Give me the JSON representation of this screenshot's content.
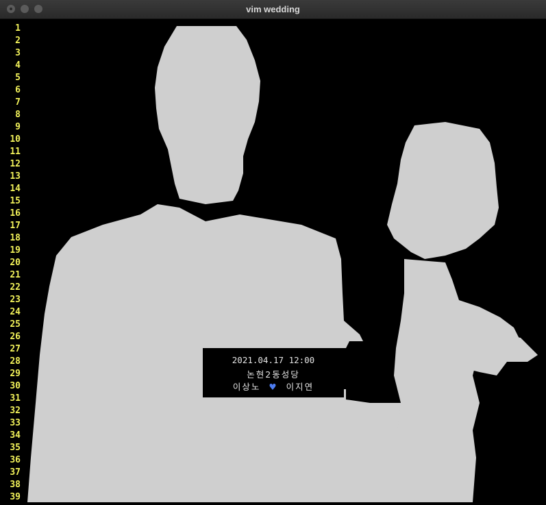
{
  "window": {
    "title": "vim wedding"
  },
  "editor": {
    "line_numbers": [
      "1",
      "2",
      "3",
      "4",
      "5",
      "6",
      "7",
      "8",
      "9",
      "10",
      "11",
      "12",
      "13",
      "14",
      "15",
      "16",
      "17",
      "18",
      "19",
      "20",
      "21",
      "22",
      "23",
      "24",
      "25",
      "26",
      "27",
      "28",
      "29",
      "30",
      "31",
      "32",
      "33",
      "34",
      "35",
      "36",
      "37",
      "38",
      "39"
    ],
    "colors": {
      "line_number": "#f2f25a",
      "background": "#000000",
      "art": "#cfcfcf",
      "heart": "#4d7df2"
    }
  },
  "invitation": {
    "datetime": "2021.04.17 12:00",
    "venue": "논현2동성당",
    "groom": "이상노",
    "bride": "이지연",
    "heart_icon": "blue-heart"
  }
}
